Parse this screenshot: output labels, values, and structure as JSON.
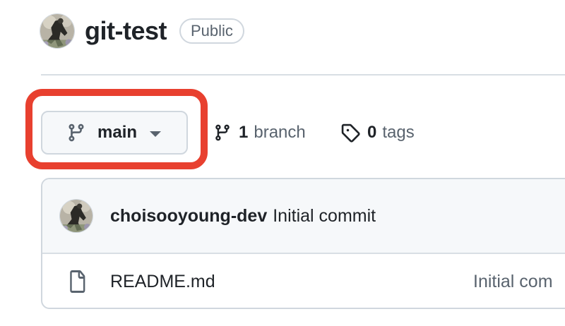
{
  "repo": {
    "name": "git-test",
    "visibility": "Public"
  },
  "branch_selector": {
    "current_branch": "main"
  },
  "stats": {
    "branch_count": "1",
    "branch_label": "branch",
    "tag_count": "0",
    "tag_label": "tags"
  },
  "latest_commit": {
    "author": "choisooyoung-dev",
    "message": "Initial commit"
  },
  "files": [
    {
      "name": "README.md",
      "last_commit": "Initial com",
      "icon": "file-icon"
    }
  ],
  "colors": {
    "highlight": "#e8402f",
    "border": "#d0d7de",
    "muted_text": "#59636e",
    "text": "#1f2328",
    "subtle_bg": "#f6f8fa"
  }
}
